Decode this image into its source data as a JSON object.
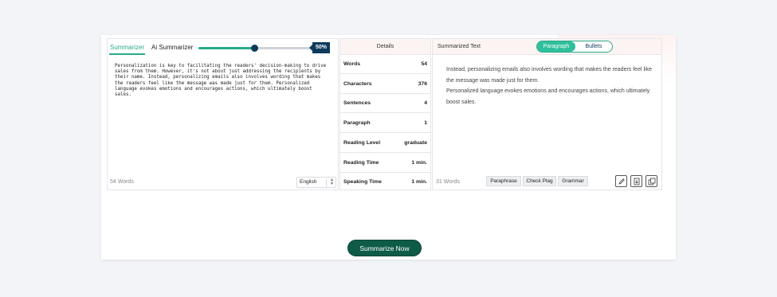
{
  "left_panel": {
    "tabs": [
      {
        "label": "Summarizer",
        "active": true
      },
      {
        "label": "Ai Summarizer",
        "active": false
      }
    ],
    "slider": {
      "value_percent": 50,
      "label": "50%"
    },
    "input_text": "Personalization is key to facilitating the readers' decision-making to drive sales from them. However, it's not about just addressing the recipients by their name. Instead, personalizing emails also involves wording that makes the readers feel like the message was made just for them. Personalized language evokes emotions and encourages actions, which ultimately boost sales.",
    "word_count": "54 Words",
    "language": "English"
  },
  "details": {
    "title": "Details",
    "rows": [
      {
        "label": "Words",
        "value": "54"
      },
      {
        "label": "Characters",
        "value": "376"
      },
      {
        "label": "Sentences",
        "value": "4"
      },
      {
        "label": "Paragraph",
        "value": "1"
      },
      {
        "label": "Reading Level",
        "value": "graduate"
      },
      {
        "label": "Reading Time",
        "value": "1 min."
      },
      {
        "label": "Speaking Time",
        "value": "1 min."
      }
    ]
  },
  "right_panel": {
    "title": "Summarized Text",
    "toggle": {
      "paragraph": "Paragraph",
      "bullets": "Bullets",
      "selected": "Paragraph"
    },
    "summary_lines": [
      "Instead, personalizing emails also involves wording that makes the readers feel like the message was made just for them.",
      "Personalized language evokes emotions and encourages actions, which ultimately boost sales."
    ],
    "word_count": "31 Words",
    "actions": {
      "paraphrase": "Paraphrase",
      "check_plag": "Check Plag",
      "grammar": "Grammar"
    },
    "icons": [
      "edit-icon",
      "download-icon",
      "copy-icon"
    ]
  },
  "summarize_button": "Summarize Now",
  "colors": {
    "accent": "#2aa98a",
    "dark_accent": "#0f5b4a",
    "slider_thumb": "#0e3a5b"
  }
}
